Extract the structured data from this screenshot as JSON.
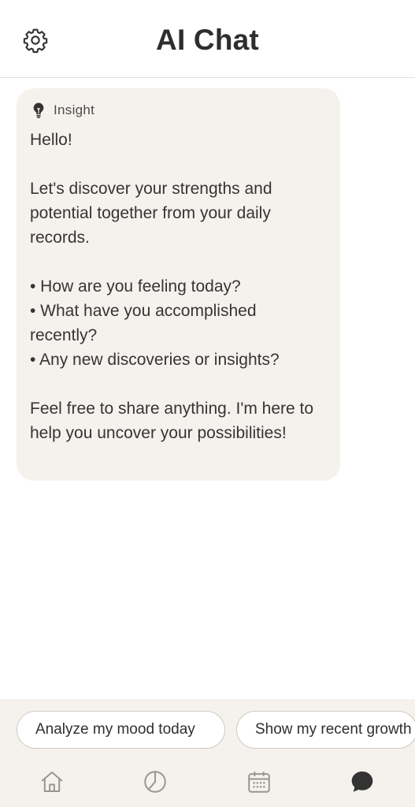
{
  "header": {
    "title": "AI Chat",
    "settings_icon": "gear-icon"
  },
  "message": {
    "tag_icon": "lightbulb-icon",
    "tag_label": "Insight",
    "text": "Hello!\n\nLet's discover your strengths and potential together from your daily records.\n\n• How are you feeling today?\n• What have you accomplished recently?\n• Any new discoveries or insights?\n\nFeel free to share anything. I'm here to help you uncover your possibilities!"
  },
  "suggestions": [
    {
      "label": "Analyze my mood today"
    },
    {
      "label": "Show my recent growth"
    }
  ],
  "tabbar": {
    "items": [
      {
        "name": "home",
        "icon": "home-icon"
      },
      {
        "name": "stats",
        "icon": "pie-chart-icon"
      },
      {
        "name": "calendar",
        "icon": "calendar-icon"
      },
      {
        "name": "chat",
        "icon": "chat-bubble-icon",
        "active": true
      }
    ]
  },
  "colors": {
    "accent": "#3a3a3a",
    "bubble_bg": "#f5f2ee",
    "icon_inactive": "#9a958e"
  }
}
